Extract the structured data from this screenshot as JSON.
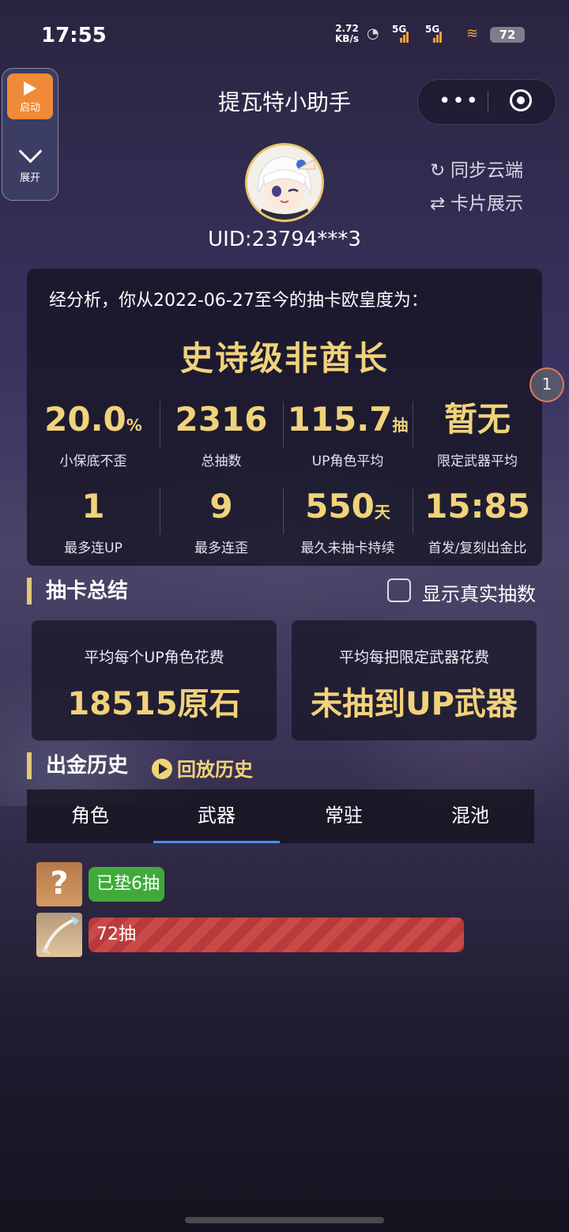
{
  "status_bar": {
    "time": "17:55",
    "net_speed_value": "2.72",
    "net_speed_unit": "KB/s",
    "sig1": "5G",
    "sig2": "5G",
    "battery": "72"
  },
  "launcher": {
    "start_label": "启动",
    "expand_label": "展开"
  },
  "header": {
    "title": "提瓦特小助手",
    "more_glyph": "•••"
  },
  "profile": {
    "uid": "UID:23794***3",
    "sync_label": "同步云端",
    "card_label": "卡片展示"
  },
  "analysis": {
    "intro": "经分析，你从2022-06-27至今的抽卡欧皇度为：",
    "verdict": "史诗级非酋长",
    "stats": [
      {
        "value": "20.0",
        "unit": "%",
        "label": "小保底不歪"
      },
      {
        "value": "2316",
        "unit": "",
        "label": "总抽数"
      },
      {
        "value": "115.7",
        "unit": "抽",
        "label": "UP角色平均"
      },
      {
        "value": "暂无",
        "unit": "",
        "label": "限定武器平均"
      },
      {
        "value": "1",
        "unit": "",
        "label": "最多连UP"
      },
      {
        "value": "9",
        "unit": "",
        "label": "最多连歪"
      },
      {
        "value": "550",
        "unit": "天",
        "label": "最久未抽卡持续"
      },
      {
        "value": "15:85",
        "unit": "",
        "label": "首发/复刻出金比"
      }
    ]
  },
  "page_marker": "1",
  "summary": {
    "header": "抽卡总结",
    "show_real_label": "显示真实抽数",
    "cards": [
      {
        "title": "平均每个UP角色花费",
        "value": "18515原石"
      },
      {
        "title": "平均每把限定武器花费",
        "value": "未抽到UP武器"
      }
    ]
  },
  "history": {
    "header": "出金历史",
    "replay_label": "回放历史",
    "tabs": [
      "角色",
      "武器",
      "常驻",
      "混池"
    ],
    "active_tab": 1,
    "rows": [
      {
        "icon": "question-icon",
        "icon_text": "?",
        "label": "已垫6抽",
        "color": "#3faa3a"
      },
      {
        "icon": "weapon-icon",
        "label": "72抽",
        "pulls": 72,
        "max_pulls": 80,
        "color": "#c94a48"
      }
    ]
  }
}
